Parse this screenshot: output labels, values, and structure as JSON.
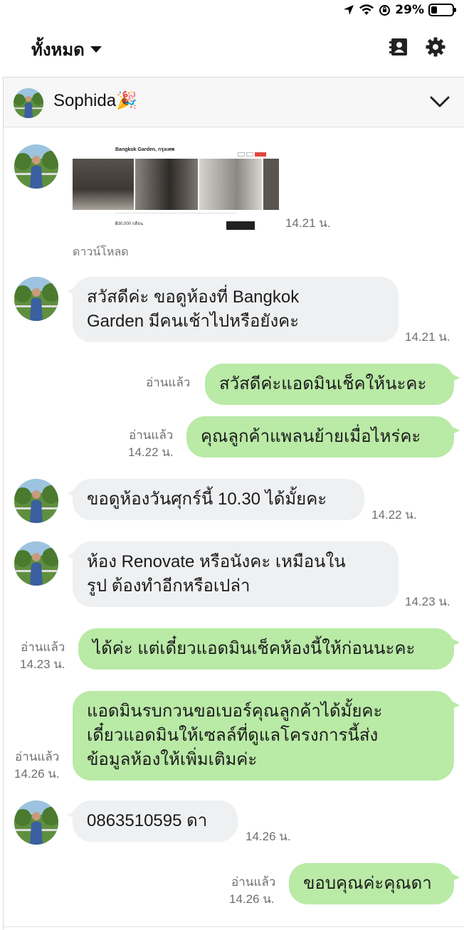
{
  "status": {
    "battery": "29%",
    "battery_level": 0.29
  },
  "header": {
    "filter_label": "ทั้งหมด",
    "contacts_icon": "contacts-icon",
    "settings_icon": "gear-icon"
  },
  "chat": {
    "contact_name": "Sophida🎉"
  },
  "messages": [
    {
      "side": "in",
      "type": "image",
      "listing_title": "Bangkok Garden, กรุงเทพ",
      "listing_price": "฿30,000 /เดือน",
      "time": "14.21 น.",
      "download_label": "ดาวน์โหลด"
    },
    {
      "side": "in",
      "text": "สวัสดีค่ะ ขอดูห้องที่ Bangkok\nGarden มีคนเช้าไปหรือยังคะ",
      "time": "14.21 น."
    },
    {
      "side": "out",
      "text": "สวัสดีค่ะแอดมินเช็คให้นะคะ",
      "read": "อ่านแล้ว",
      "time": ""
    },
    {
      "side": "out",
      "text": "คุณลูกค้าแพลนย้ายเมื่อไหร่คะ",
      "read": "อ่านแล้ว",
      "time": "14.22 น."
    },
    {
      "side": "in",
      "text": "ขอดูห้องวันศุกร์นี้ 10.30 ได้มั้ยคะ",
      "time": "14.22 น."
    },
    {
      "side": "in",
      "text": "ห้อง Renovate หรือนังคะ เหมือนใน\nรูป ต้องทำอีกหรือเปล่า",
      "time": "14.23 น."
    },
    {
      "side": "out",
      "text": "ได้ค่ะ แต่เดี๋ยวแอดมินเช็คห้องนี้ให้ก่อนนะคะ",
      "read": "อ่านแล้ว",
      "time": "14.23 น."
    },
    {
      "side": "out",
      "text": "แอดมินรบกวนขอเบอร์คุณลูกค้าได้มั้ยคะ\nเดี๋ยวแอดมินให้เซลล์ที่ดูแลโครงการนี้ส่ง\nข้อมูลห้องให้เพิ่มเติมค่ะ",
      "read": "อ่านแล้ว",
      "time": "14.26 น."
    },
    {
      "side": "in",
      "text": "0863510595 ดา",
      "time": "14.26 น."
    },
    {
      "side": "out",
      "text": "ขอบคุณค่ะคุณดา",
      "read": "อ่านแล้ว",
      "time": "14.26 น."
    }
  ]
}
